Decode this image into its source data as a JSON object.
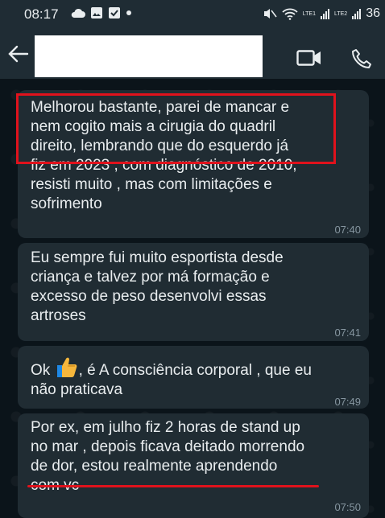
{
  "status_bar": {
    "time": "08:17",
    "battery": "36",
    "sim1": "LTE1",
    "sim2": "LTE2"
  },
  "header": {
    "icons": [
      "back-arrow-icon",
      "video-call-icon",
      "phone-call-icon"
    ]
  },
  "messages": [
    {
      "text": "Melhorou bastante, parei de mancar e\nnem cogito mais a cirugia do quadril\ndireito, lembrando que do esquerdo já\nfiz em 2023 , com diagnóstico de 2010,\nresisti muito , mas com limitações e\nsofrimento",
      "time": "07:40"
    },
    {
      "text": "Eu sempre fui muito esportista desde\ncriança e talvez por má formação e\nexcesso de peso desenvolvi essas\nartroses",
      "time": "07:41"
    },
    {
      "text_before": "Ok ",
      "text_after": ", é A consciência corporal , que eu\nnão praticava",
      "time": "07:49"
    },
    {
      "text": "Por ex, em julho fiz 2 horas de stand up\nno mar , depois ficava deitado morrendo\nde dor, estou realmente aprendendo\ncom vc",
      "time": "07:50"
    }
  ],
  "colors": {
    "annotation": "#e0121c",
    "bubble": "#202c33",
    "background": "#0b141a"
  }
}
